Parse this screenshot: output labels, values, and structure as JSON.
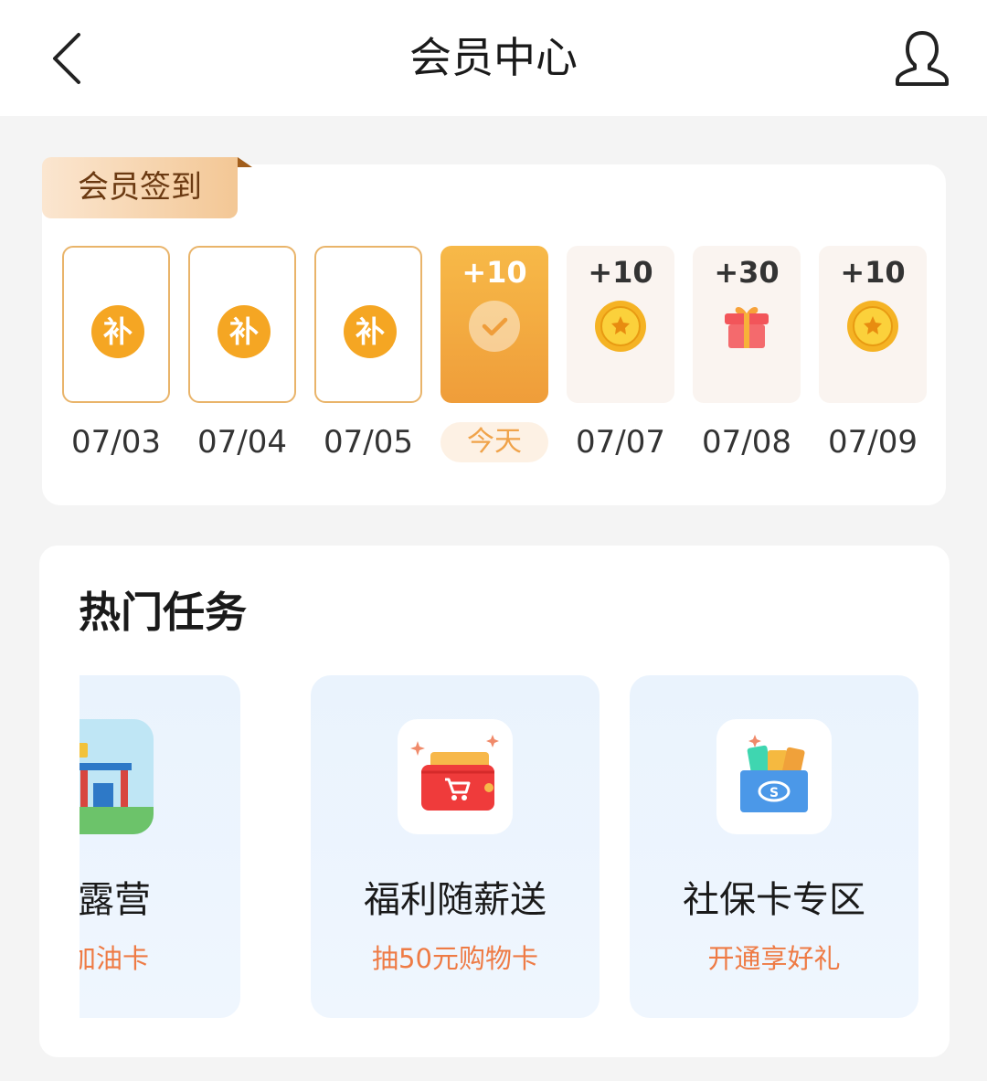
{
  "header": {
    "title": "会员中心"
  },
  "checkin": {
    "ribbon": "会员签到",
    "days": [
      {
        "date": "07/03",
        "status": "missed",
        "badge": "补"
      },
      {
        "date": "07/04",
        "status": "missed",
        "badge": "补"
      },
      {
        "date": "07/05",
        "status": "missed",
        "badge": "补"
      },
      {
        "date": "今天",
        "status": "today",
        "points": "+10"
      },
      {
        "date": "07/07",
        "status": "future",
        "points": "+10",
        "reward": "coin-icon"
      },
      {
        "date": "07/08",
        "status": "future",
        "points": "+30",
        "reward": "gift-icon"
      },
      {
        "date": "07/09",
        "status": "future",
        "points": "+10",
        "reward": "coin-icon"
      }
    ]
  },
  "tasks": {
    "title": "热门任务",
    "items": [
      {
        "name": "云露营",
        "sub": "元加油卡",
        "icon": "gas-card-icon"
      },
      {
        "name": "福利随薪送",
        "sub": "抽50元购物卡",
        "icon": "wallet-icon"
      },
      {
        "name": "社保卡专区",
        "sub": "开通享好礼",
        "icon": "social-security-card-icon"
      }
    ]
  },
  "colors": {
    "accent": "#f0a34a",
    "today_card": "#ef9d3a",
    "task_sub": "#ee7b45"
  }
}
